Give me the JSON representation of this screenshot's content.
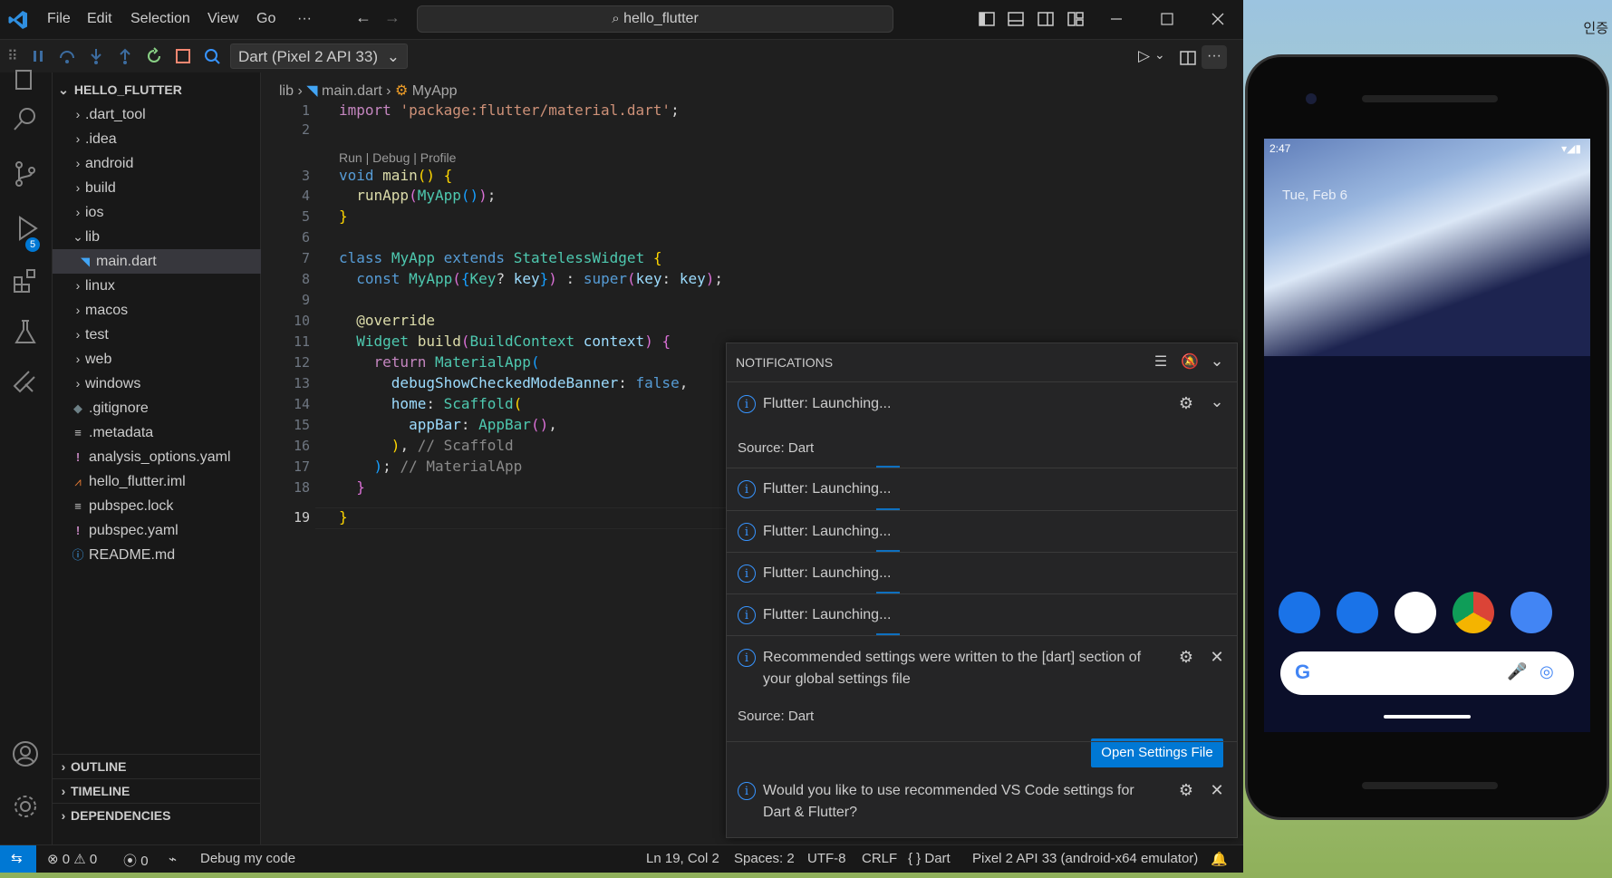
{
  "desktop": {
    "corner_text": "인증"
  },
  "titlebar": {
    "menus": [
      "File",
      "Edit",
      "Selection",
      "View",
      "Go",
      "···"
    ],
    "search_text": "hello_flutter"
  },
  "debug": {
    "config_label": "Dart (Pixel 2 API 33)"
  },
  "activity": {
    "run_debug_badge": "5"
  },
  "explorer": {
    "root": "HELLO_FLUTTER",
    "items": [
      {
        "label": ".dart_tool",
        "type": "folder"
      },
      {
        "label": ".idea",
        "type": "folder"
      },
      {
        "label": "android",
        "type": "folder"
      },
      {
        "label": "build",
        "type": "folder"
      },
      {
        "label": "ios",
        "type": "folder"
      },
      {
        "label": "lib",
        "type": "folder-open"
      },
      {
        "label": "main.dart",
        "type": "dart"
      },
      {
        "label": "linux",
        "type": "folder"
      },
      {
        "label": "macos",
        "type": "folder"
      },
      {
        "label": "test",
        "type": "folder"
      },
      {
        "label": "web",
        "type": "folder"
      },
      {
        "label": "windows",
        "type": "folder"
      },
      {
        "label": ".gitignore",
        "type": "git"
      },
      {
        "label": ".metadata",
        "type": "lines"
      },
      {
        "label": "analysis_options.yaml",
        "type": "yaml"
      },
      {
        "label": "hello_flutter.iml",
        "type": "rss"
      },
      {
        "label": "pubspec.lock",
        "type": "lines"
      },
      {
        "label": "pubspec.yaml",
        "type": "yaml"
      },
      {
        "label": "README.md",
        "type": "info"
      }
    ],
    "sections": [
      "OUTLINE",
      "TIMELINE",
      "DEPENDENCIES"
    ]
  },
  "editor": {
    "breadcrumb": [
      "lib",
      "main.dart",
      "MyApp"
    ],
    "codelens": "Run | Debug | Profile",
    "line_numbers": [
      "1",
      "2",
      "3",
      "4",
      "5",
      "6",
      "7",
      "8",
      "9",
      "10",
      "11",
      "12",
      "13",
      "14",
      "15",
      "16",
      "17",
      "18",
      "19"
    ]
  },
  "notifications": {
    "header": "NOTIFICATIONS",
    "launching": "Flutter: Launching...",
    "source": "Source: Dart",
    "recommended": "Recommended settings were written to the [dart] section of",
    "recommended_2": "your global settings file",
    "open_settings": "Open Settings File",
    "would_like": "Would you like to use recommended VS Code settings for",
    "would_like_2": "Dart & Flutter?"
  },
  "statusbar": {
    "errors": "0",
    "warnings": "0",
    "ports": "0",
    "debug_label": "Debug my code",
    "position": "Ln 19, Col 2",
    "spaces": "Spaces: 2",
    "encoding": "UTF-8",
    "eol": "CRLF",
    "language": "Dart",
    "device": "Pixel 2 API 33 (android-x64 emulator)"
  },
  "phone": {
    "time": "2:47",
    "date": "Tue, Feb 6"
  }
}
